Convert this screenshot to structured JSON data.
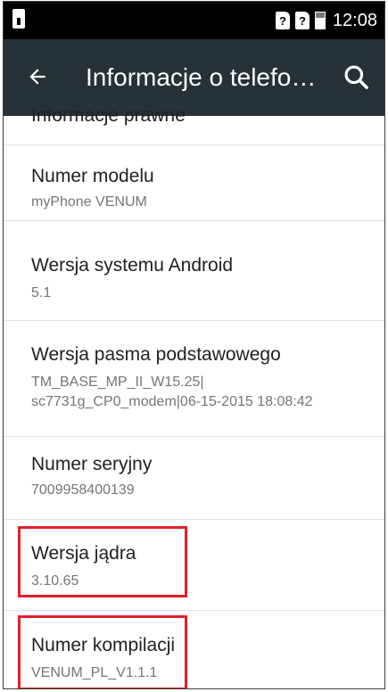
{
  "status_bar": {
    "sim1": "?",
    "sim2": "?",
    "time": "12:08"
  },
  "app_bar": {
    "title": "Informacje o telefo…",
    "back_icon": "arrow-left-icon",
    "search_icon": "search-icon"
  },
  "list": {
    "partial_item": {
      "title": "Informacje prawne"
    },
    "items": [
      {
        "title": "Numer modelu",
        "value": "myPhone VENUM"
      },
      {
        "title": "Wersja systemu Android",
        "value": "5.1"
      },
      {
        "title": "Wersja pasma podstawowego",
        "value": "TM_BASE_MP_II_W15.25|\nsc7731g_CP0_modem|06-15-2015 18:08:42"
      },
      {
        "title": "Numer seryjny",
        "value": "7009958400139"
      },
      {
        "title": "Wersja jądra",
        "value": "3.10.65"
      },
      {
        "title": "Numer kompilacji",
        "value": "VENUM_PL_V1.1.1"
      }
    ]
  },
  "colors": {
    "status_bar": "#000000",
    "app_bar": "#263238",
    "highlight": "#e0202a"
  }
}
